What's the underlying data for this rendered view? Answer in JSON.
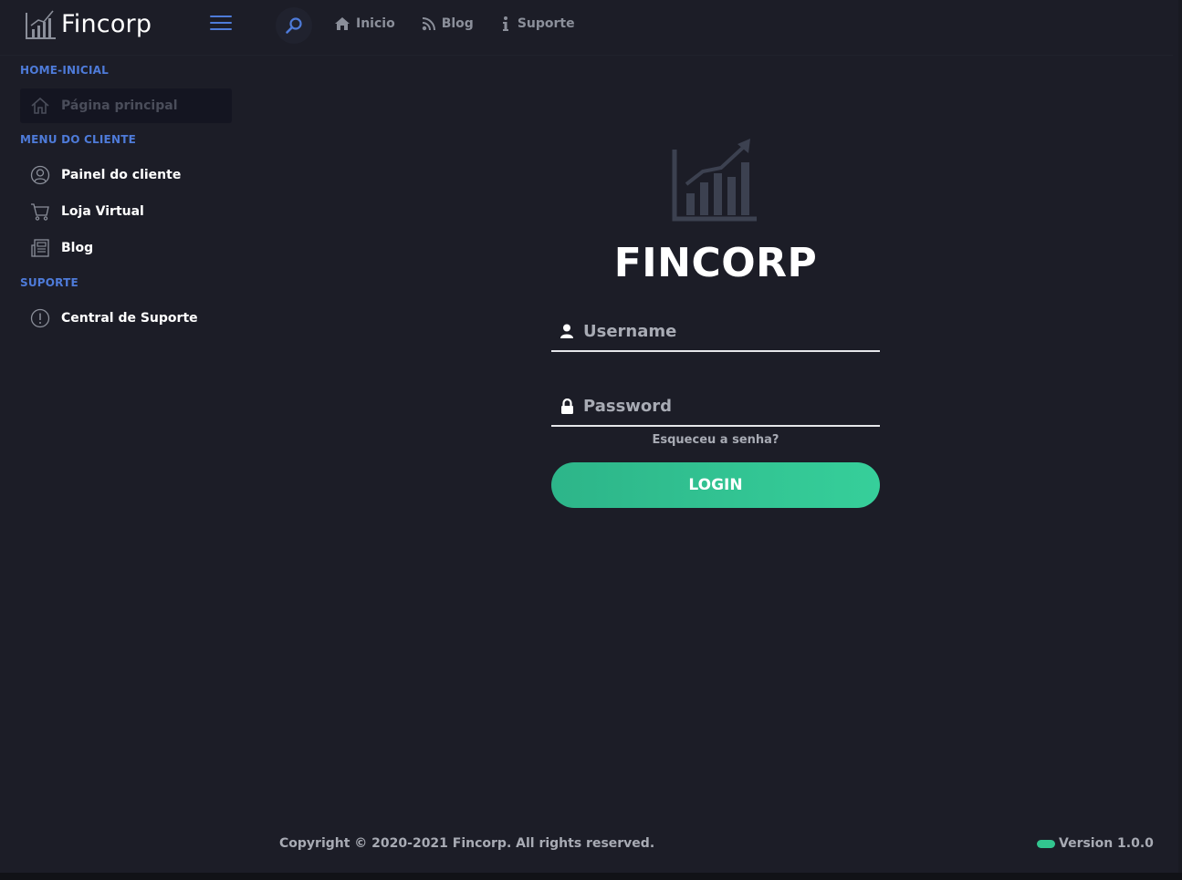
{
  "header": {
    "brand_name": "Fincorp",
    "nav": [
      {
        "label": "Inicio",
        "icon": "home-icon"
      },
      {
        "label": "Blog",
        "icon": "rss-icon"
      },
      {
        "label": "Suporte",
        "icon": "info-icon"
      }
    ]
  },
  "sidebar": {
    "sections": [
      {
        "title": "HOME-INICIAL",
        "items": [
          {
            "label": "Página principal",
            "icon": "house-icon",
            "active": true
          }
        ]
      },
      {
        "title": "MENU DO CLIENTE",
        "items": [
          {
            "label": "Painel do cliente",
            "icon": "user-circle-icon"
          },
          {
            "label": "Loja Virtual",
            "icon": "cart-icon"
          },
          {
            "label": "Blog",
            "icon": "newspaper-icon"
          }
        ]
      },
      {
        "title": "SUPORTE",
        "items": [
          {
            "label": "Central de Suporte",
            "icon": "alert-circle-icon"
          }
        ]
      }
    ]
  },
  "login": {
    "title": "FINCORP",
    "username_placeholder": "Username",
    "password_placeholder": "Password",
    "forgot_label": "Esqueceu a senha?",
    "button_label": "LOGIN"
  },
  "footer": {
    "copyright": "Copyright © 2020-2021 Fincorp. All rights reserved.",
    "version": "Version 1.0.0"
  },
  "colors": {
    "background": "#1c1d27",
    "accent_blue": "#4e7bd9",
    "accent_green": "#32c58f",
    "muted_text": "#a8abb4"
  }
}
